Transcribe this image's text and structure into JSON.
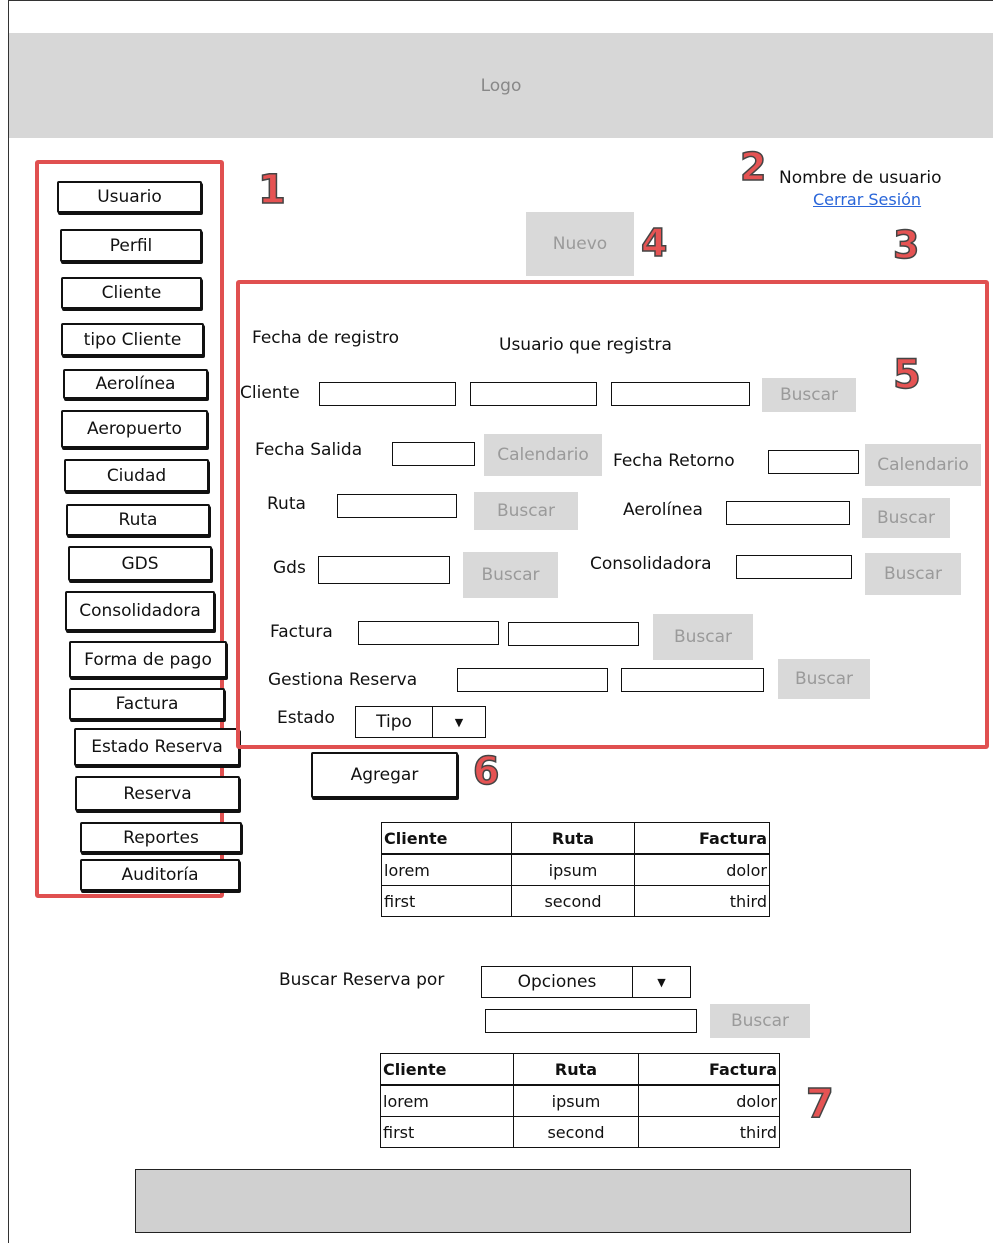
{
  "header": {
    "logo_text": "Logo"
  },
  "user": {
    "name": "Nombre de usuario",
    "logout_link": "Cerrar Sesión"
  },
  "annotations": {
    "n1": "1",
    "n2": "2",
    "n3": "3",
    "n4": "4",
    "n5": "5",
    "n6": "6",
    "n7": "7"
  },
  "sidebar": {
    "items": [
      {
        "label": "Usuario"
      },
      {
        "label": "Perfil"
      },
      {
        "label": "Cliente"
      },
      {
        "label": "tipo Cliente"
      },
      {
        "label": "Aerolínea"
      },
      {
        "label": "Aeropuerto"
      },
      {
        "label": "Ciudad"
      },
      {
        "label": "Ruta"
      },
      {
        "label": "GDS"
      },
      {
        "label": "Consolidadora"
      },
      {
        "label": "Forma de pago"
      },
      {
        "label": "Factura"
      },
      {
        "label": "Estado Reserva"
      },
      {
        "label": "Reserva"
      },
      {
        "label": "Reportes"
      },
      {
        "label": "Auditoría"
      }
    ]
  },
  "toolbar": {
    "new_label": "Nuevo"
  },
  "form": {
    "fecha_registro_label": "Fecha de registro",
    "usuario_registra_label": "Usuario que registra",
    "cliente_label": "Cliente",
    "fecha_salida_label": "Fecha Salida",
    "fecha_retorno_label": "Fecha Retorno",
    "ruta_label": "Ruta",
    "aerolinea_label": "Aerolínea",
    "gds_label": "Gds",
    "consolidadora_label": "Consolidadora",
    "factura_label": "Factura",
    "gestiona_label": "Gestiona Reserva",
    "estado_label": "Estado",
    "estado_select": "Tipo",
    "buscar_label": "Buscar",
    "calendario_label": "Calendario",
    "agregar_label": "Agregar"
  },
  "table1": {
    "headers": [
      "Cliente",
      "Ruta",
      "Factura"
    ],
    "rows": [
      [
        "lorem",
        "ipsum",
        "dolor"
      ],
      [
        "first",
        "second",
        "third"
      ]
    ]
  },
  "search": {
    "label": "Buscar Reserva por",
    "select_value": "Opciones",
    "button": "Buscar"
  },
  "table2": {
    "headers": [
      "Cliente",
      "Ruta",
      "Factura"
    ],
    "rows": [
      [
        "lorem",
        "ipsum",
        "dolor"
      ],
      [
        "first",
        "second",
        "third"
      ]
    ]
  }
}
